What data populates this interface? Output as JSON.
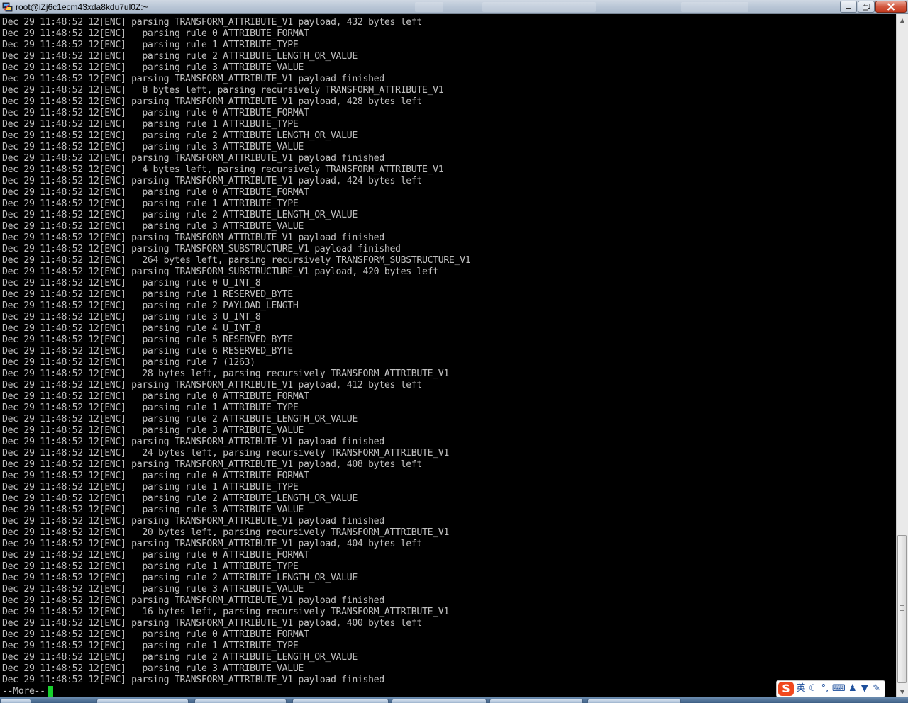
{
  "window": {
    "title": "root@iZj6c1ecm43xda8kdu7ul0Z:~"
  },
  "terminal": {
    "lines": [
      "Dec 29 11:48:52 12[ENC] parsing TRANSFORM_ATTRIBUTE_V1 payload, 432 bytes left",
      "Dec 29 11:48:52 12[ENC]   parsing rule 0 ATTRIBUTE_FORMAT",
      "Dec 29 11:48:52 12[ENC]   parsing rule 1 ATTRIBUTE_TYPE",
      "Dec 29 11:48:52 12[ENC]   parsing rule 2 ATTRIBUTE_LENGTH_OR_VALUE",
      "Dec 29 11:48:52 12[ENC]   parsing rule 3 ATTRIBUTE_VALUE",
      "Dec 29 11:48:52 12[ENC] parsing TRANSFORM_ATTRIBUTE_V1 payload finished",
      "Dec 29 11:48:52 12[ENC]   8 bytes left, parsing recursively TRANSFORM_ATTRIBUTE_V1",
      "Dec 29 11:48:52 12[ENC] parsing TRANSFORM_ATTRIBUTE_V1 payload, 428 bytes left",
      "Dec 29 11:48:52 12[ENC]   parsing rule 0 ATTRIBUTE_FORMAT",
      "Dec 29 11:48:52 12[ENC]   parsing rule 1 ATTRIBUTE_TYPE",
      "Dec 29 11:48:52 12[ENC]   parsing rule 2 ATTRIBUTE_LENGTH_OR_VALUE",
      "Dec 29 11:48:52 12[ENC]   parsing rule 3 ATTRIBUTE_VALUE",
      "Dec 29 11:48:52 12[ENC] parsing TRANSFORM_ATTRIBUTE_V1 payload finished",
      "Dec 29 11:48:52 12[ENC]   4 bytes left, parsing recursively TRANSFORM_ATTRIBUTE_V1",
      "Dec 29 11:48:52 12[ENC] parsing TRANSFORM_ATTRIBUTE_V1 payload, 424 bytes left",
      "Dec 29 11:48:52 12[ENC]   parsing rule 0 ATTRIBUTE_FORMAT",
      "Dec 29 11:48:52 12[ENC]   parsing rule 1 ATTRIBUTE_TYPE",
      "Dec 29 11:48:52 12[ENC]   parsing rule 2 ATTRIBUTE_LENGTH_OR_VALUE",
      "Dec 29 11:48:52 12[ENC]   parsing rule 3 ATTRIBUTE_VALUE",
      "Dec 29 11:48:52 12[ENC] parsing TRANSFORM_ATTRIBUTE_V1 payload finished",
      "Dec 29 11:48:52 12[ENC] parsing TRANSFORM_SUBSTRUCTURE_V1 payload finished",
      "Dec 29 11:48:52 12[ENC]   264 bytes left, parsing recursively TRANSFORM_SUBSTRUCTURE_V1",
      "Dec 29 11:48:52 12[ENC] parsing TRANSFORM_SUBSTRUCTURE_V1 payload, 420 bytes left",
      "Dec 29 11:48:52 12[ENC]   parsing rule 0 U_INT_8",
      "Dec 29 11:48:52 12[ENC]   parsing rule 1 RESERVED_BYTE",
      "Dec 29 11:48:52 12[ENC]   parsing rule 2 PAYLOAD_LENGTH",
      "Dec 29 11:48:52 12[ENC]   parsing rule 3 U_INT_8",
      "Dec 29 11:48:52 12[ENC]   parsing rule 4 U_INT_8",
      "Dec 29 11:48:52 12[ENC]   parsing rule 5 RESERVED_BYTE",
      "Dec 29 11:48:52 12[ENC]   parsing rule 6 RESERVED_BYTE",
      "Dec 29 11:48:52 12[ENC]   parsing rule 7 (1263)",
      "Dec 29 11:48:52 12[ENC]   28 bytes left, parsing recursively TRANSFORM_ATTRIBUTE_V1",
      "Dec 29 11:48:52 12[ENC] parsing TRANSFORM_ATTRIBUTE_V1 payload, 412 bytes left",
      "Dec 29 11:48:52 12[ENC]   parsing rule 0 ATTRIBUTE_FORMAT",
      "Dec 29 11:48:52 12[ENC]   parsing rule 1 ATTRIBUTE_TYPE",
      "Dec 29 11:48:52 12[ENC]   parsing rule 2 ATTRIBUTE_LENGTH_OR_VALUE",
      "Dec 29 11:48:52 12[ENC]   parsing rule 3 ATTRIBUTE_VALUE",
      "Dec 29 11:48:52 12[ENC] parsing TRANSFORM_ATTRIBUTE_V1 payload finished",
      "Dec 29 11:48:52 12[ENC]   24 bytes left, parsing recursively TRANSFORM_ATTRIBUTE_V1",
      "Dec 29 11:48:52 12[ENC] parsing TRANSFORM_ATTRIBUTE_V1 payload, 408 bytes left",
      "Dec 29 11:48:52 12[ENC]   parsing rule 0 ATTRIBUTE_FORMAT",
      "Dec 29 11:48:52 12[ENC]   parsing rule 1 ATTRIBUTE_TYPE",
      "Dec 29 11:48:52 12[ENC]   parsing rule 2 ATTRIBUTE_LENGTH_OR_VALUE",
      "Dec 29 11:48:52 12[ENC]   parsing rule 3 ATTRIBUTE_VALUE",
      "Dec 29 11:48:52 12[ENC] parsing TRANSFORM_ATTRIBUTE_V1 payload finished",
      "Dec 29 11:48:52 12[ENC]   20 bytes left, parsing recursively TRANSFORM_ATTRIBUTE_V1",
      "Dec 29 11:48:52 12[ENC] parsing TRANSFORM_ATTRIBUTE_V1 payload, 404 bytes left",
      "Dec 29 11:48:52 12[ENC]   parsing rule 0 ATTRIBUTE_FORMAT",
      "Dec 29 11:48:52 12[ENC]   parsing rule 1 ATTRIBUTE_TYPE",
      "Dec 29 11:48:52 12[ENC]   parsing rule 2 ATTRIBUTE_LENGTH_OR_VALUE",
      "Dec 29 11:48:52 12[ENC]   parsing rule 3 ATTRIBUTE_VALUE",
      "Dec 29 11:48:52 12[ENC] parsing TRANSFORM_ATTRIBUTE_V1 payload finished",
      "Dec 29 11:48:52 12[ENC]   16 bytes left, parsing recursively TRANSFORM_ATTRIBUTE_V1",
      "Dec 29 11:48:52 12[ENC] parsing TRANSFORM_ATTRIBUTE_V1 payload, 400 bytes left",
      "Dec 29 11:48:52 12[ENC]   parsing rule 0 ATTRIBUTE_FORMAT",
      "Dec 29 11:48:52 12[ENC]   parsing rule 1 ATTRIBUTE_TYPE",
      "Dec 29 11:48:52 12[ENC]   parsing rule 2 ATTRIBUTE_LENGTH_OR_VALUE",
      "Dec 29 11:48:52 12[ENC]   parsing rule 3 ATTRIBUTE_VALUE",
      "Dec 29 11:48:52 12[ENC] parsing TRANSFORM_ATTRIBUTE_V1 payload finished"
    ],
    "pager_prompt": "--More--",
    "text_color": "#c0c0c0",
    "background_color": "#000000",
    "cursor_color": "#17d12d"
  },
  "ime": {
    "logo": "S",
    "mode": "英",
    "icons": [
      "moon-icon",
      "punctuation-icon",
      "keyboard-icon",
      "user-icon",
      "shirt-icon",
      "wrench-icon"
    ]
  },
  "icons": {
    "app": "putty-terminal-icon",
    "minimize": "minimize-icon",
    "maximize": "maximize-icon",
    "close": "close-icon",
    "scroll_up": "arrow-up-icon",
    "scroll_down": "arrow-down-icon"
  }
}
